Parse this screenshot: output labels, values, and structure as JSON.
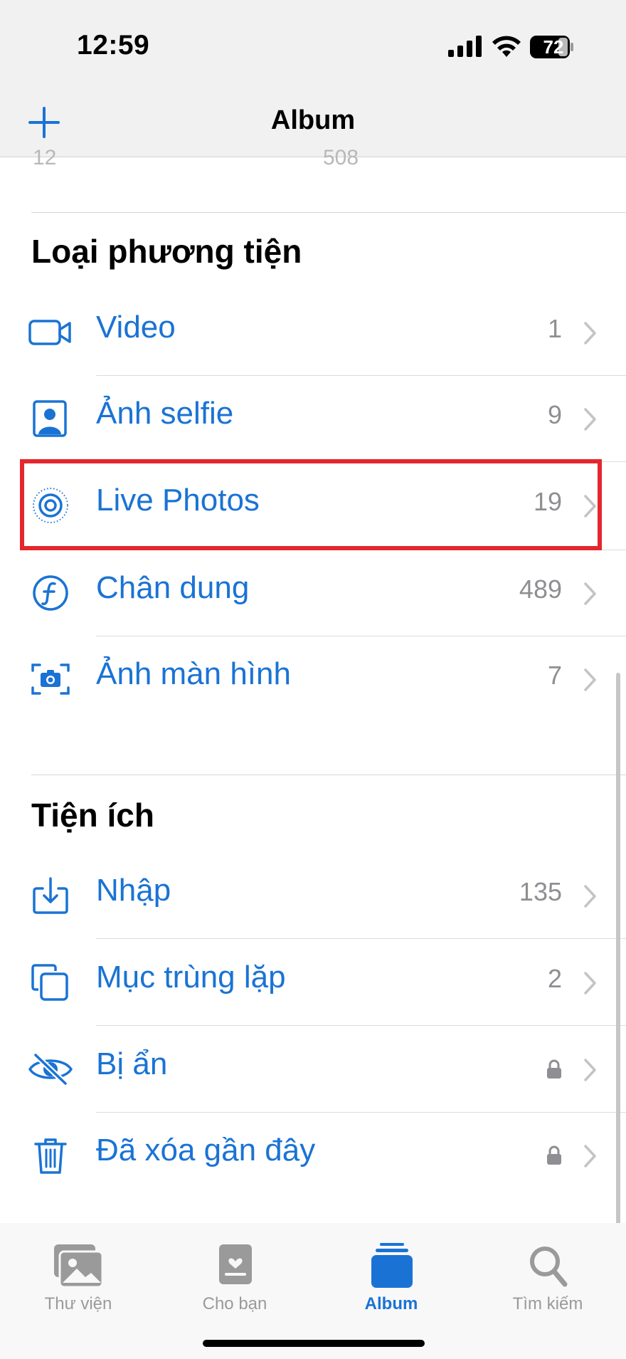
{
  "status": {
    "time": "12:59",
    "battery": "72"
  },
  "nav": {
    "title": "Album"
  },
  "cutoff_row": {
    "left": "12",
    "right": "508"
  },
  "media_types": {
    "title": "Loại phương tiện",
    "items": [
      {
        "label": "Video",
        "count": "1",
        "icon": "video-icon"
      },
      {
        "label": "Ảnh selfie",
        "count": "9",
        "icon": "portrait-selfie-icon"
      },
      {
        "label": "Live Photos",
        "count": "19",
        "icon": "live-photo-icon"
      },
      {
        "label": "Chân dung",
        "count": "489",
        "icon": "portrait-f-icon"
      },
      {
        "label": "Ảnh màn hình",
        "count": "7",
        "icon": "screenshot-icon"
      }
    ]
  },
  "utilities": {
    "title": "Tiện ích",
    "items": [
      {
        "label": "Nhập",
        "count": "135",
        "icon": "import-icon"
      },
      {
        "label": "Mục trùng lặp",
        "count": "2",
        "icon": "duplicates-icon"
      },
      {
        "label": "Bị ẩn",
        "count": "",
        "icon": "hidden-eye-icon",
        "locked": true
      },
      {
        "label": "Đã xóa gần đây",
        "count": "",
        "icon": "trash-icon",
        "locked": true
      }
    ]
  },
  "tabs": [
    {
      "label": "Thư viện",
      "icon": "photos-library-icon",
      "active": false
    },
    {
      "label": "Cho bạn",
      "icon": "for-you-icon",
      "active": false
    },
    {
      "label": "Album",
      "icon": "albums-icon",
      "active": true
    },
    {
      "label": "Tìm kiếm",
      "icon": "search-icon",
      "active": false
    }
  ],
  "colors": {
    "accent": "#1a73d4",
    "highlight": "#e3272d",
    "secondary": "#8e8e93"
  }
}
